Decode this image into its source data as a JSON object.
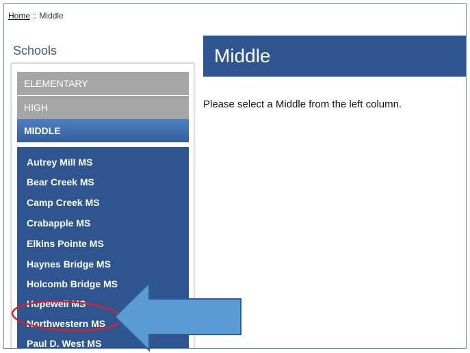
{
  "breadcrumb": {
    "home": "Home",
    "separator": " :: ",
    "current": "Middle"
  },
  "sidebar": {
    "title": "Schools",
    "categories": [
      {
        "label": "ELEMENTARY"
      },
      {
        "label": "HIGH"
      },
      {
        "label": "MIDDLE"
      }
    ],
    "schools": [
      {
        "label": "Autrey Mill MS"
      },
      {
        "label": "Bear Creek MS"
      },
      {
        "label": "Camp Creek MS"
      },
      {
        "label": "Crabapple MS"
      },
      {
        "label": "Elkins Pointe MS"
      },
      {
        "label": "Haynes Bridge MS"
      },
      {
        "label": "Holcomb Bridge MS"
      },
      {
        "label": "Hopewell MS"
      },
      {
        "label": "Northwestern MS"
      },
      {
        "label": "Paul D. West MS"
      }
    ]
  },
  "main": {
    "title": "Middle",
    "instruction": "Please select a Middle from the left column."
  },
  "annotation": {
    "color_ring": "#d8202a",
    "color_arrow": "#5b9bd5",
    "color_arrow_border": "#2e5c93"
  }
}
